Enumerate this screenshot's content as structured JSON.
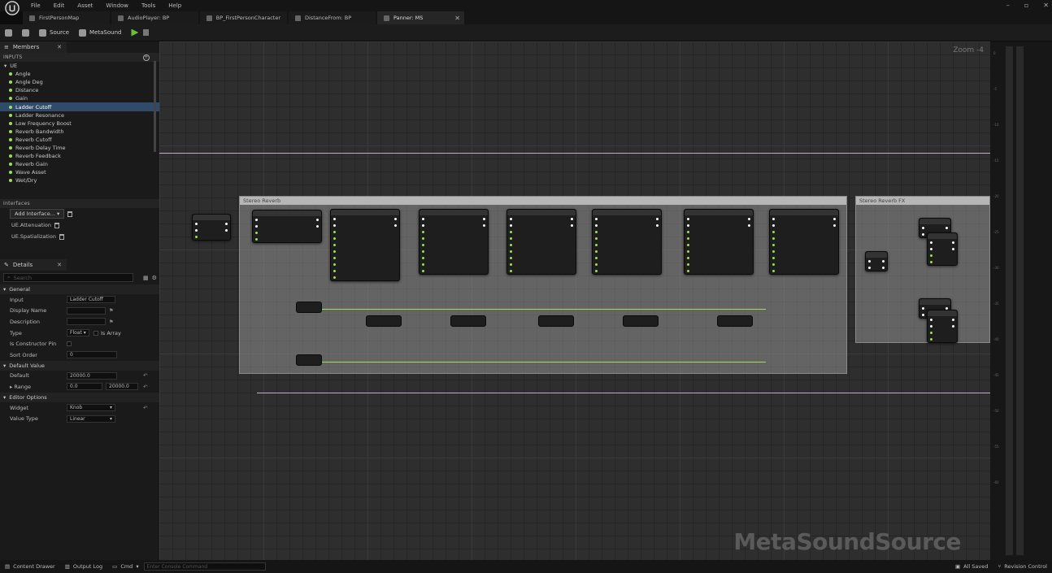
{
  "menu": [
    "File",
    "Edit",
    "Asset",
    "Window",
    "Tools",
    "Help"
  ],
  "tabs": [
    {
      "label": "FirstPersonMap"
    },
    {
      "label": "AudioPlayer: BP"
    },
    {
      "label": "BP_FirstPersonCharacter"
    },
    {
      "label": "DistanceFrom: BP"
    },
    {
      "label": "Panner: MS"
    }
  ],
  "toolbar": {
    "source": "Source",
    "metasound": "MetaSound"
  },
  "members": {
    "tab": "Members",
    "inputs_header": "INPUTS",
    "ue": "UE",
    "items": [
      "Angle",
      "Angle Deg",
      "Distance",
      "Gain",
      "Ladder Cutoff",
      "Ladder Resonance",
      "Low Frequency Boost",
      "Reverb Bandwidth",
      "Reverb Cutoff",
      "Reverb Delay Time",
      "Reverb Feedback",
      "Reverb Gain",
      "Wave Asset",
      "Wet/Dry"
    ]
  },
  "interfaces": {
    "header": "Interfaces",
    "add": "Add Interface...",
    "items": [
      "UE.Attenuation",
      "UE.Spatialization"
    ]
  },
  "details": {
    "tab": "Details",
    "search": "Search",
    "general": "General",
    "input_label": "Input",
    "input_value": "Ladder Cutoff",
    "display_name": "Display Name",
    "description": "Description",
    "type_label": "Type",
    "type_value": "Float",
    "is_array": "Is Array",
    "is_constructor": "Is Constructor Pin",
    "sort_order": "Sort Order",
    "sort_value": "0",
    "default_value": "Default Value",
    "default_label": "Default",
    "default_val": "20000.0",
    "range_label": "Range",
    "range_min": "0.0",
    "range_max": "20000.0",
    "editor_options": "Editor Options",
    "widget_label": "Widget",
    "widget_value": "Knob",
    "value_type_label": "Value Type",
    "value_type_value": "Linear"
  },
  "graph": {
    "zoom": "Zoom -4",
    "watermark": "MetaSoundSource",
    "comment1": "Stereo Reverb",
    "comment2": "Stereo Reverb FX"
  },
  "meter_ticks": [
    "0",
    "-5",
    "-10",
    "-15",
    "-20",
    "-25",
    "-30",
    "-35",
    "-40",
    "-45",
    "-50",
    "-55",
    "-60"
  ],
  "status": {
    "content_drawer": "Content Drawer",
    "output_log": "Output Log",
    "cmd": "Cmd",
    "cmd_placeholder": "Enter Console Command",
    "all_saved": "All Saved",
    "revision": "Revision Control"
  }
}
